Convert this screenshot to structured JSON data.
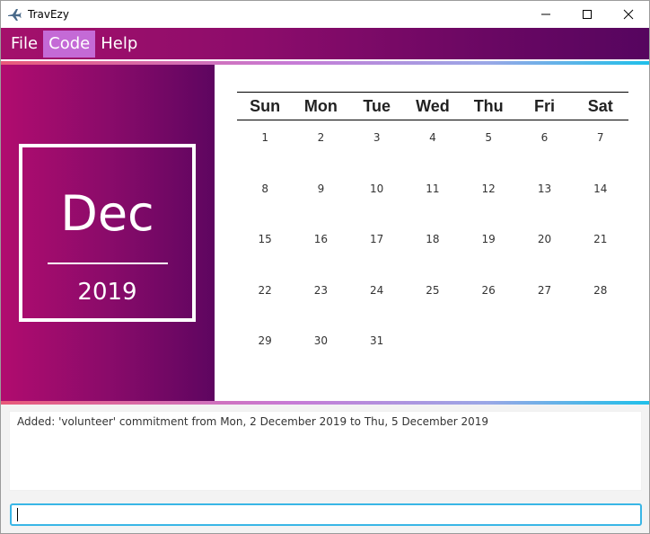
{
  "window": {
    "title": "TravEzy",
    "icon": "airplane-icon",
    "controls": [
      "minimize-icon",
      "maximize-icon",
      "close-icon"
    ]
  },
  "menu": {
    "items": [
      {
        "label": "File",
        "active": false
      },
      {
        "label": "Code",
        "active": true
      },
      {
        "label": "Help",
        "active": false
      }
    ]
  },
  "date_panel": {
    "month": "Dec",
    "year": "2019"
  },
  "calendar": {
    "weekdays": [
      "Sun",
      "Mon",
      "Tue",
      "Wed",
      "Thu",
      "Fri",
      "Sat"
    ],
    "weeks": [
      [
        "1",
        "2",
        "3",
        "4",
        "5",
        "6",
        "7"
      ],
      [
        "8",
        "9",
        "10",
        "11",
        "12",
        "13",
        "14"
      ],
      [
        "15",
        "16",
        "17",
        "18",
        "19",
        "20",
        "21"
      ],
      [
        "22",
        "23",
        "24",
        "25",
        "26",
        "27",
        "28"
      ],
      [
        "29",
        "30",
        "31",
        "",
        "",
        "",
        ""
      ]
    ]
  },
  "result": {
    "text": "Added: 'volunteer' commitment from Mon, 2 December 2019 to Thu, 5 December 2019"
  },
  "command": {
    "value": ""
  },
  "colors": {
    "panel_start": "#b10c6f",
    "panel_end": "#5e0560",
    "menu_active": "#c46ad6",
    "command_border": "#39b6e6"
  }
}
